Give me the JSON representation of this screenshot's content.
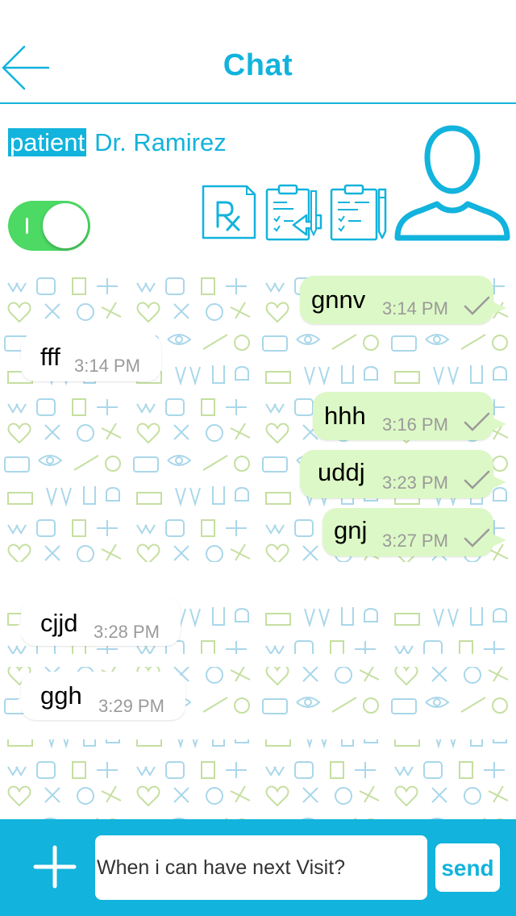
{
  "header": {
    "title": "Chat",
    "back_icon": "arrow-left-icon"
  },
  "contact": {
    "role_tag": "patient",
    "name": "Dr. Ramirez",
    "toggle_on": true,
    "toggle_mark": "I",
    "actions": [
      "prescription-rx-icon",
      "clipboard-import-icon",
      "clipboard-edit-icon"
    ],
    "avatar_icon": "user-avatar-icon"
  },
  "messages": [
    {
      "dir": "out",
      "text": "gnnv",
      "time": "3:14 PM",
      "read": true
    },
    {
      "dir": "in",
      "text": "fff",
      "time": "3:14 PM"
    },
    {
      "dir": "out",
      "text": "hhh",
      "time": "3:16 PM",
      "read": true
    },
    {
      "dir": "out",
      "text": "uddj",
      "time": "3:23 PM",
      "read": true
    },
    {
      "dir": "out",
      "text": "gnj",
      "time": "3:27 PM",
      "read": true
    },
    {
      "dir": "in",
      "text": "cjjd",
      "time": "3:28 PM"
    },
    {
      "dir": "in",
      "text": "ggh",
      "time": "3:29 PM"
    }
  ],
  "composer": {
    "input_value": "When i can have next Visit?",
    "send_label": "send",
    "plus_icon": "plus-icon"
  },
  "colors": {
    "accent": "#12b3dc",
    "outgoing_bubble": "#dcf8c6",
    "incoming_bubble": "#ffffff",
    "toggle_on": "#4cd964"
  }
}
